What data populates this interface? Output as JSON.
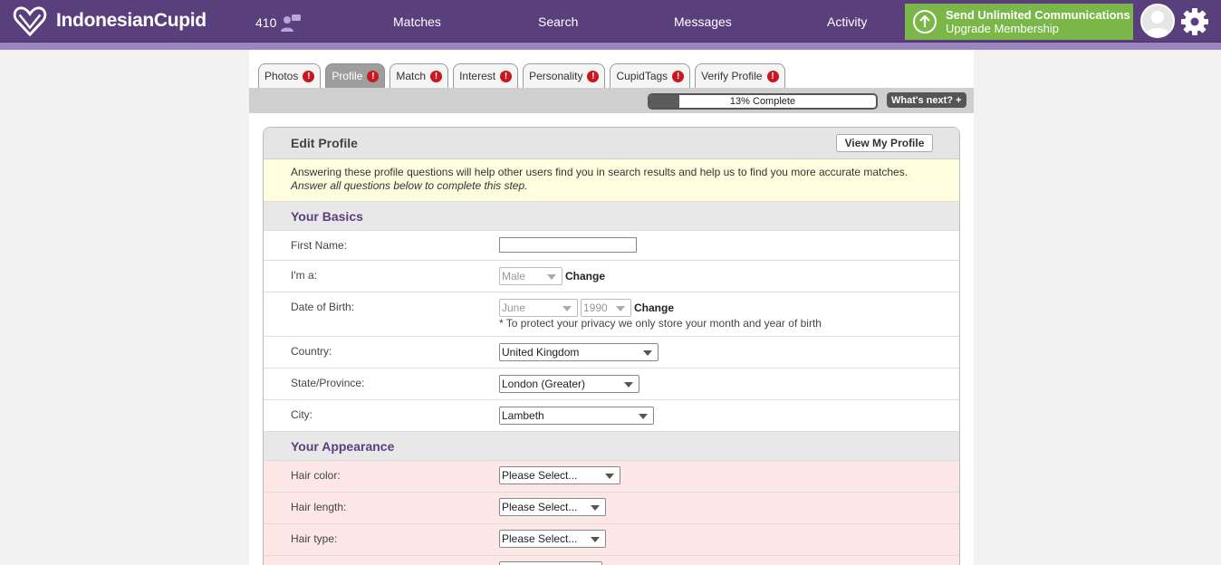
{
  "brand": {
    "name": "IndonesianCupid"
  },
  "header": {
    "count": "410",
    "nav": [
      "Matches",
      "Search",
      "Messages",
      "Activity"
    ],
    "upgrade": {
      "title": "Send Unlimited Communications",
      "subtitle": "Upgrade Membership"
    }
  },
  "tabs": [
    {
      "label": "Photos"
    },
    {
      "label": "Profile",
      "active": true
    },
    {
      "label": "Match"
    },
    {
      "label": "Interest"
    },
    {
      "label": "Personality"
    },
    {
      "label": "CupidTags"
    },
    {
      "label": "Verify Profile"
    }
  ],
  "progress": {
    "label": "13% Complete",
    "fraction": 0.13,
    "whats_next": "What's next? +"
  },
  "panel": {
    "title": "Edit Profile",
    "view_button": "View My Profile",
    "intro_line1": "Answering these profile questions will help other users find you in search results and help us to find you more accurate matches.",
    "intro_line2": "Answer all questions below to complete this step."
  },
  "basics": {
    "heading": "Your Basics",
    "first_name_label": "First Name:",
    "first_name_value": "",
    "gender_label": "I'm a:",
    "gender_value": "Male",
    "change": "Change",
    "dob_label": "Date of Birth:",
    "dob_month": "June",
    "dob_year": "1990",
    "dob_note": "* To protect your privacy we only store your month and year of birth",
    "country_label": "Country:",
    "country_value": "United Kingdom",
    "state_label": "State/Province:",
    "state_value": "London (Greater)",
    "city_label": "City:",
    "city_value": "Lambeth"
  },
  "appearance": {
    "heading": "Your Appearance",
    "hair_color_label": "Hair color:",
    "hair_length_label": "Hair length:",
    "hair_type_label": "Hair type:",
    "please_select": "Please Select..."
  },
  "colors": {
    "header": "#5a3f7d",
    "upgrade": "#7ab648",
    "warning": "#c8171e"
  }
}
